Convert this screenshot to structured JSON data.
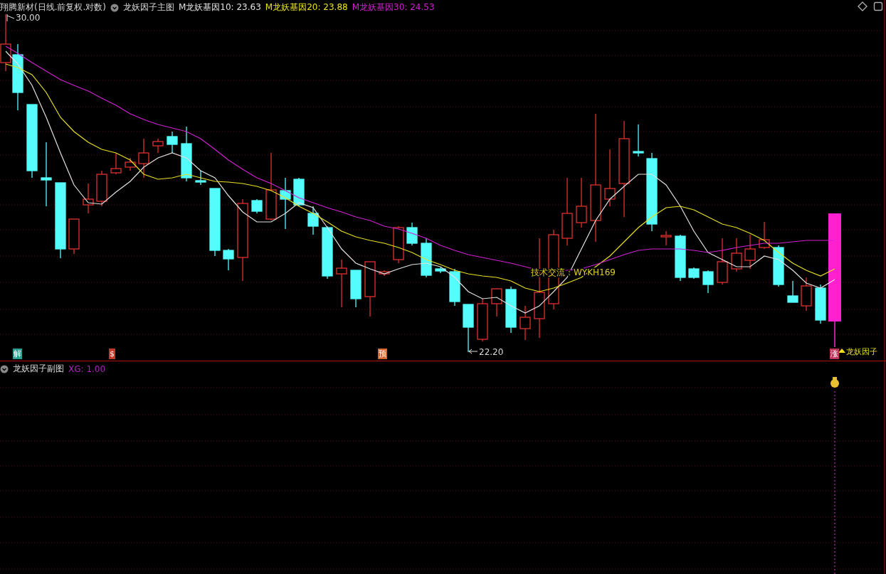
{
  "main_panel": {
    "stock_title": "翔腾新材(日线.前复权.对数)",
    "indicator_name": "龙妖因子主图",
    "moving_averages": [
      {
        "text": "M龙妖基因10: 23.63",
        "color": "#e0e0e0"
      },
      {
        "text": "M龙妖基因20: 23.88",
        "color": "#e8e020"
      },
      {
        "text": "M龙妖基因30: 24.53",
        "color": "#d020d0"
      }
    ],
    "high_label": "30.00",
    "low_label": "22.20",
    "annotation": "技术交流：WYKH169",
    "markers": [
      {
        "text": "解",
        "color": "#2a9d8f"
      },
      {
        "text": "$",
        "color": "#c0392b"
      },
      {
        "text": "预",
        "color": "#d9642a"
      },
      {
        "text": "涨",
        "color": "#c0305a"
      }
    ],
    "signal_label": "龙妖因子"
  },
  "sub_panel": {
    "indicator_name": "龙妖因子副图",
    "reading": "XG: 1.00"
  }
}
